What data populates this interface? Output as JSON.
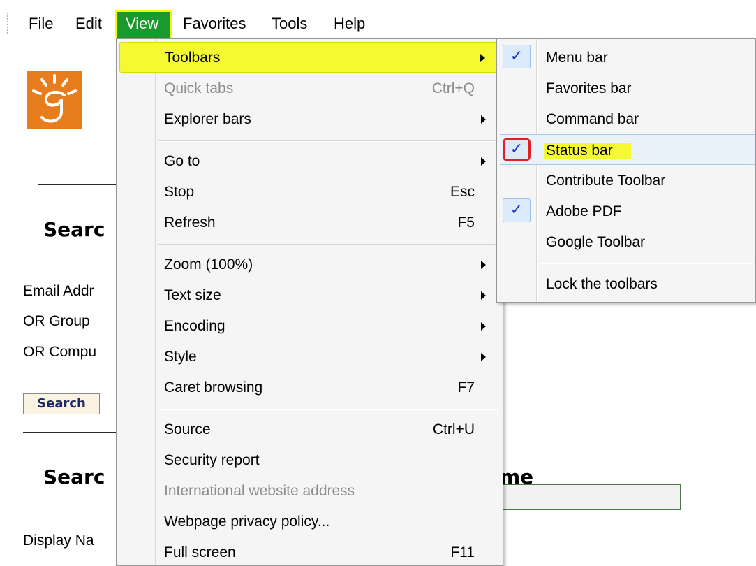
{
  "menubar": {
    "items": [
      {
        "label": "File"
      },
      {
        "label": "Edit"
      },
      {
        "label": "View"
      },
      {
        "label": "Favorites"
      },
      {
        "label": "Tools"
      },
      {
        "label": "Help"
      }
    ],
    "active_color": "#1a9a2e",
    "active_outline": "#f0ff00"
  },
  "page": {
    "logo_color": "#e87d1e",
    "heading1": "Searc",
    "email_label": "Email Addr",
    "or_group": "OR   Group",
    "or_computer": "OR  Compu",
    "search_button": "Search",
    "heading2_start": "Searc",
    "heading2_end": "me",
    "display_name": "Display Na"
  },
  "view_menu": {
    "items": [
      {
        "label": "Toolbars",
        "shortcut": "",
        "submenu": true,
        "highlight": true
      },
      {
        "label": "Quick tabs",
        "shortcut": "Ctrl+Q",
        "disabled": true
      },
      {
        "label": "Explorer bars",
        "shortcut": "",
        "submenu": true
      },
      {
        "label": "Go to",
        "shortcut": "",
        "submenu": true
      },
      {
        "label": "Stop",
        "shortcut": "Esc"
      },
      {
        "label": "Refresh",
        "shortcut": "F5"
      },
      {
        "label": "Zoom (100%)",
        "shortcut": "",
        "submenu": true
      },
      {
        "label": "Text size",
        "shortcut": "",
        "submenu": true
      },
      {
        "label": "Encoding",
        "shortcut": "",
        "submenu": true
      },
      {
        "label": "Style",
        "shortcut": "",
        "submenu": true
      },
      {
        "label": "Caret browsing",
        "shortcut": "F7"
      },
      {
        "label": "Source",
        "shortcut": "Ctrl+U"
      },
      {
        "label": "Security report",
        "shortcut": ""
      },
      {
        "label": "International website address",
        "shortcut": "",
        "disabled": true
      },
      {
        "label": "Webpage privacy policy...",
        "shortcut": ""
      },
      {
        "label": "Full screen",
        "shortcut": "F11"
      }
    ],
    "highlight_color": "#f4f931"
  },
  "toolbars_submenu": {
    "items": [
      {
        "label": "Menu bar",
        "checked": true
      },
      {
        "label": "Favorites bar",
        "checked": false
      },
      {
        "label": "Command bar",
        "checked": false
      },
      {
        "label": "Status bar",
        "checked": true,
        "selected": true,
        "annotated": true
      },
      {
        "label": "Contribute Toolbar",
        "checked": false
      },
      {
        "label": "Adobe PDF",
        "checked": true
      },
      {
        "label": "Google Toolbar",
        "checked": false
      },
      {
        "label": "Lock the toolbars",
        "checked": false
      }
    ],
    "check_glyph": "✓",
    "check_color": "#1f2fd6",
    "annotation_color": "#e22020"
  }
}
